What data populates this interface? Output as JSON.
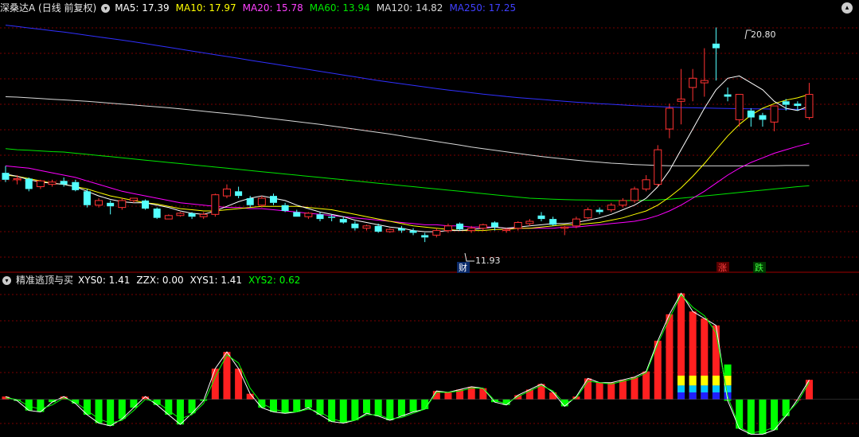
{
  "colors": {
    "up": "#ff3232",
    "down": "#54ffff",
    "ma5": "#ffffff",
    "ma10": "#ffff00",
    "ma20": "#ff00ff",
    "ma60": "#00e600",
    "ma120": "#d8d8d8",
    "ma250": "#3030ff",
    "grid": "#7a0000",
    "osc_red": "#ff2020",
    "osc_green": "#00ff00",
    "osc_yellow": "#ffff00",
    "osc_blue": "#2020ff",
    "osc_cyan": "#00c8ff"
  },
  "header": {
    "title": "深桑达A (日线 前复权)",
    "menu_icon": "circle-down-icon",
    "ma5": "MA5: 17.39",
    "ma10": "MA10: 17.97",
    "ma20": "MA20: 15.78",
    "ma60": "MA60: 13.94",
    "ma120": "MA120: 14.82",
    "ma250": "MA250: 17.25"
  },
  "subheader": {
    "title": "精准逃顶与买",
    "xys0": "XYS0: 1.41",
    "zzx": "ZZX: 0.00",
    "xys1": "XYS1: 1.41",
    "xys2": "XYS2: 0.62"
  },
  "annotations": {
    "high_label": "20.80",
    "low_label": "11.93",
    "marker_cai": "财",
    "marker_zhang": "涨",
    "marker_die": "跌"
  },
  "chart_data": [
    {
      "type": "candlestick",
      "ylim": [
        10.4,
        21.3
      ],
      "grid": true,
      "high": 20.8,
      "low": 11.93,
      "candles": [
        [
          14.5,
          14.2,
          14.8,
          14.1
        ],
        [
          14.2,
          14.25,
          14.4,
          14.0
        ],
        [
          14.25,
          13.8,
          14.3,
          13.7
        ],
        [
          13.9,
          14.15,
          14.2,
          13.8
        ],
        [
          14.0,
          14.1,
          14.2,
          13.9
        ],
        [
          14.15,
          14.0,
          14.3,
          13.9
        ],
        [
          14.1,
          13.75,
          14.2,
          13.7
        ],
        [
          13.7,
          13.1,
          13.8,
          13.0
        ],
        [
          13.1,
          13.3,
          13.4,
          13.0
        ],
        [
          13.2,
          13.05,
          13.3,
          12.7
        ],
        [
          13.0,
          13.3,
          13.4,
          12.9
        ],
        [
          13.3,
          13.4,
          13.4,
          13.2
        ],
        [
          13.3,
          12.95,
          13.35,
          12.9
        ],
        [
          12.95,
          12.55,
          13.0,
          12.5
        ],
        [
          12.5,
          12.65,
          12.7,
          12.5
        ],
        [
          12.65,
          12.75,
          12.8,
          12.6
        ],
        [
          12.75,
          12.6,
          12.8,
          12.5
        ],
        [
          12.6,
          12.7,
          12.8,
          12.5
        ],
        [
          12.7,
          13.55,
          13.6,
          12.6
        ],
        [
          13.5,
          13.8,
          14.0,
          13.4
        ],
        [
          13.7,
          13.5,
          13.9,
          13.4
        ],
        [
          13.4,
          13.1,
          13.5,
          13.0
        ],
        [
          13.1,
          13.4,
          13.5,
          13.0
        ],
        [
          13.5,
          13.2,
          13.6,
          13.1
        ],
        [
          13.1,
          12.85,
          13.2,
          12.8
        ],
        [
          12.8,
          12.6,
          12.9,
          12.6
        ],
        [
          12.6,
          12.75,
          12.8,
          12.5
        ],
        [
          12.7,
          12.5,
          12.8,
          12.4
        ],
        [
          12.6,
          12.55,
          12.7,
          12.4
        ],
        [
          12.5,
          12.35,
          12.6,
          12.3
        ],
        [
          12.3,
          12.1,
          12.4,
          12.0
        ],
        [
          12.1,
          12.2,
          12.25,
          12.0
        ],
        [
          12.2,
          11.95,
          12.3,
          11.9
        ],
        [
          11.95,
          12.05,
          12.1,
          11.9
        ],
        [
          12.1,
          12.0,
          12.2,
          11.9
        ],
        [
          12.0,
          11.9,
          12.1,
          11.8
        ],
        [
          11.8,
          11.7,
          11.9,
          11.5
        ],
        [
          11.8,
          12.0,
          12.1,
          11.7
        ],
        [
          12.0,
          12.2,
          12.3,
          11.9
        ],
        [
          12.3,
          12.05,
          12.35,
          12.0
        ],
        [
          12.0,
          12.1,
          12.2,
          11.9
        ],
        [
          12.1,
          12.25,
          12.3,
          12.0
        ],
        [
          12.35,
          12.15,
          12.4,
          12.0
        ],
        [
          12.0,
          12.05,
          12.1,
          11.9
        ],
        [
          12.1,
          12.35,
          12.4,
          12.0
        ],
        [
          12.3,
          12.4,
          12.5,
          12.2
        ],
        [
          12.65,
          12.5,
          12.8,
          12.4
        ],
        [
          12.5,
          12.25,
          12.6,
          12.2
        ],
        [
          12.1,
          12.15,
          12.2,
          11.8
        ],
        [
          12.2,
          12.5,
          12.6,
          12.1
        ],
        [
          12.55,
          12.9,
          13.0,
          12.5
        ],
        [
          12.9,
          12.8,
          13.0,
          12.7
        ],
        [
          12.9,
          13.1,
          13.2,
          12.8
        ],
        [
          13.1,
          13.3,
          13.4,
          13.0
        ],
        [
          13.3,
          13.8,
          13.9,
          13.2
        ],
        [
          13.8,
          14.2,
          14.4,
          13.7
        ],
        [
          14.0,
          15.5,
          15.7,
          13.9
        ],
        [
          16.4,
          17.3,
          17.5,
          16.0
        ],
        [
          17.6,
          17.7,
          19.0,
          16.6
        ],
        [
          18.2,
          18.6,
          19.0,
          17.6
        ],
        [
          18.4,
          18.5,
          19.9,
          17.8
        ],
        [
          20.1,
          19.9,
          20.8,
          18.5
        ],
        [
          17.9,
          17.8,
          18.2,
          17.6
        ],
        [
          16.8,
          17.9,
          17.9,
          16.5
        ],
        [
          17.2,
          16.9,
          17.3,
          16.5
        ],
        [
          17.0,
          16.8,
          17.1,
          16.5
        ],
        [
          16.7,
          17.4,
          17.4,
          16.3
        ],
        [
          17.6,
          17.45,
          17.7,
          17.2
        ],
        [
          17.5,
          17.4,
          17.6,
          17.2
        ],
        [
          16.9,
          17.9,
          18.4,
          16.8
        ]
      ],
      "ma5": [
        14.45,
        14.35,
        14.2,
        14.1,
        14.05,
        14.0,
        13.9,
        13.7,
        13.5,
        13.35,
        13.25,
        13.2,
        13.2,
        13.1,
        13.0,
        12.85,
        12.75,
        12.7,
        12.85,
        13.05,
        13.25,
        13.4,
        13.5,
        13.4,
        13.3,
        13.1,
        12.95,
        12.8,
        12.7,
        12.6,
        12.45,
        12.35,
        12.25,
        12.15,
        12.1,
        12.0,
        11.95,
        11.95,
        12.0,
        12.0,
        12.05,
        12.1,
        12.15,
        12.1,
        12.15,
        12.2,
        12.25,
        12.3,
        12.3,
        12.35,
        12.45,
        12.55,
        12.7,
        12.9,
        13.1,
        13.4,
        13.9,
        14.6,
        15.5,
        16.4,
        17.3,
        18.1,
        18.6,
        18.7,
        18.4,
        18.1,
        17.6,
        17.3,
        17.2,
        17.4
      ],
      "ma10": [
        14.4,
        14.35,
        14.25,
        14.15,
        14.05,
        14.0,
        13.9,
        13.8,
        13.65,
        13.5,
        13.4,
        13.3,
        13.2,
        13.15,
        13.05,
        12.95,
        12.9,
        12.85,
        12.85,
        12.9,
        12.95,
        13.0,
        13.05,
        13.05,
        13.05,
        13.05,
        13.0,
        12.95,
        12.9,
        12.8,
        12.7,
        12.6,
        12.5,
        12.4,
        12.3,
        12.2,
        12.15,
        12.1,
        12.05,
        12.0,
        12.0,
        12.0,
        12.05,
        12.05,
        12.1,
        12.1,
        12.15,
        12.2,
        12.25,
        12.25,
        12.3,
        12.35,
        12.45,
        12.55,
        12.7,
        12.85,
        13.1,
        13.45,
        13.85,
        14.35,
        14.9,
        15.5,
        16.1,
        16.6,
        17.0,
        17.3,
        17.5,
        17.65,
        17.75,
        17.9
      ],
      "ma20": [
        14.8,
        14.75,
        14.7,
        14.6,
        14.5,
        14.4,
        14.3,
        14.15,
        14.0,
        13.85,
        13.7,
        13.6,
        13.5,
        13.4,
        13.3,
        13.2,
        13.15,
        13.1,
        13.05,
        13.0,
        13.0,
        12.95,
        12.95,
        12.9,
        12.85,
        12.8,
        12.75,
        12.7,
        12.65,
        12.6,
        12.55,
        12.5,
        12.45,
        12.4,
        12.35,
        12.3,
        12.25,
        12.25,
        12.2,
        12.2,
        12.15,
        12.15,
        12.15,
        12.1,
        12.1,
        12.1,
        12.1,
        12.1,
        12.15,
        12.15,
        12.2,
        12.25,
        12.3,
        12.35,
        12.4,
        12.5,
        12.65,
        12.85,
        13.1,
        13.4,
        13.7,
        14.05,
        14.4,
        14.7,
        14.95,
        15.15,
        15.35,
        15.5,
        15.65,
        15.78
      ],
      "ma60": [
        15.55,
        15.5,
        15.48,
        15.45,
        15.42,
        15.4,
        15.35,
        15.3,
        15.25,
        15.2,
        15.15,
        15.1,
        15.05,
        15.0,
        14.95,
        14.9,
        14.85,
        14.8,
        14.75,
        14.7,
        14.65,
        14.6,
        14.55,
        14.5,
        14.45,
        14.4,
        14.35,
        14.3,
        14.25,
        14.2,
        14.15,
        14.1,
        14.05,
        14.0,
        13.95,
        13.9,
        13.85,
        13.8,
        13.75,
        13.7,
        13.65,
        13.6,
        13.55,
        13.5,
        13.45,
        13.4,
        13.38,
        13.36,
        13.34,
        13.33,
        13.32,
        13.31,
        13.3,
        13.3,
        13.3,
        13.31,
        13.33,
        13.36,
        13.4,
        13.45,
        13.5,
        13.55,
        13.6,
        13.65,
        13.7,
        13.75,
        13.8,
        13.85,
        13.9,
        13.94
      ],
      "ma120": [
        17.8,
        17.78,
        17.75,
        17.72,
        17.69,
        17.66,
        17.63,
        17.6,
        17.56,
        17.52,
        17.48,
        17.44,
        17.4,
        17.36,
        17.32,
        17.27,
        17.22,
        17.17,
        17.12,
        17.07,
        17.02,
        16.96,
        16.9,
        16.84,
        16.78,
        16.72,
        16.66,
        16.6,
        16.53,
        16.46,
        16.39,
        16.32,
        16.25,
        16.18,
        16.1,
        16.02,
        15.94,
        15.86,
        15.78,
        15.7,
        15.62,
        15.55,
        15.48,
        15.41,
        15.34,
        15.27,
        15.21,
        15.15,
        15.1,
        15.05,
        15.0,
        14.96,
        14.92,
        14.89,
        14.86,
        14.84,
        14.82,
        14.81,
        14.8,
        14.8,
        14.8,
        14.8,
        14.8,
        14.8,
        14.8,
        14.81,
        14.81,
        14.82,
        14.82,
        14.82
      ],
      "ma250": [
        20.9,
        20.84,
        20.78,
        20.72,
        20.66,
        20.6,
        20.53,
        20.46,
        20.39,
        20.32,
        20.25,
        20.18,
        20.1,
        20.02,
        19.94,
        19.86,
        19.78,
        19.7,
        19.62,
        19.54,
        19.46,
        19.38,
        19.3,
        19.22,
        19.14,
        19.06,
        18.98,
        18.9,
        18.82,
        18.74,
        18.66,
        18.58,
        18.5,
        18.43,
        18.36,
        18.29,
        18.22,
        18.15,
        18.09,
        18.03,
        17.97,
        17.91,
        17.86,
        17.81,
        17.76,
        17.72,
        17.68,
        17.64,
        17.6,
        17.56,
        17.53,
        17.5,
        17.47,
        17.44,
        17.41,
        17.39,
        17.37,
        17.35,
        17.33,
        17.32,
        17.31,
        17.3,
        17.29,
        17.28,
        17.27,
        17.27,
        17.26,
        17.26,
        17.25,
        17.25
      ]
    },
    {
      "type": "bar",
      "ylim": [
        -1.35,
        4.1
      ],
      "grid": true,
      "xys0": [
        0.1,
        -0.05,
        -0.4,
        -0.45,
        -0.1,
        0.1,
        -0.15,
        -0.55,
        -0.85,
        -0.95,
        -0.7,
        -0.3,
        0.1,
        -0.2,
        -0.55,
        -0.9,
        -0.5,
        -0.05,
        1.1,
        1.7,
        1.1,
        0.2,
        -0.3,
        -0.45,
        -0.5,
        -0.45,
        -0.3,
        -0.55,
        -0.8,
        -0.85,
        -0.75,
        -0.5,
        -0.6,
        -0.75,
        -0.6,
        -0.45,
        -0.35,
        0.3,
        0.25,
        0.35,
        0.45,
        0.4,
        -0.1,
        -0.2,
        0.15,
        0.35,
        0.55,
        0.25,
        -0.25,
        0.1,
        0.75,
        0.6,
        0.6,
        0.7,
        0.8,
        1.0,
        2.1,
        3.05,
        3.8,
        3.15,
        2.9,
        2.65,
        -0.05,
        -1.05,
        -1.25,
        -1.25,
        -1.1,
        -0.6,
        0.0,
        0.7
      ],
      "xys2": [
        0.05,
        0.0,
        -0.25,
        -0.35,
        -0.2,
        0.05,
        -0.1,
        -0.4,
        -0.7,
        -0.85,
        -0.75,
        -0.4,
        0.0,
        -0.1,
        -0.4,
        -0.7,
        -0.55,
        -0.15,
        0.8,
        1.6,
        1.3,
        0.4,
        -0.15,
        -0.35,
        -0.45,
        -0.45,
        -0.35,
        -0.45,
        -0.7,
        -0.8,
        -0.75,
        -0.55,
        -0.55,
        -0.7,
        -0.65,
        -0.5,
        -0.35,
        0.25,
        0.25,
        0.3,
        0.4,
        0.4,
        -0.05,
        -0.15,
        0.1,
        0.3,
        0.5,
        0.3,
        -0.15,
        0.05,
        0.65,
        0.6,
        0.55,
        0.65,
        0.75,
        0.95,
        2.0,
        2.9,
        3.75,
        3.3,
        3.0,
        2.4,
        0.1,
        -1.0,
        -1.2,
        -1.15,
        -1.0,
        -0.55,
        -0.1,
        0.62
      ]
    }
  ]
}
